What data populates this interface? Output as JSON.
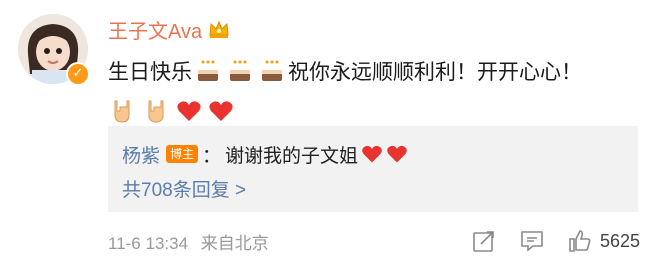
{
  "comment": {
    "username": "王子文Ava",
    "text_part1": "生日快乐",
    "text_part2": "祝你永远顺顺利利！开开心心！"
  },
  "reply": {
    "username": "杨紫",
    "tag": "博主",
    "separator": "：",
    "text": "谢谢我的子文姐",
    "more_label": "共708条回复 >"
  },
  "footer": {
    "date": "11-6 13:34",
    "source": "来自北京",
    "like_count": "5625"
  },
  "icons": {
    "verified": "verified-badge-icon",
    "crown": "crown-icon",
    "cake": "cake-icon",
    "hand": "rock-hand-icon",
    "heart": "heart-icon",
    "share": "share-icon",
    "comment": "comment-icon",
    "like": "thumbs-up-icon"
  },
  "colors": {
    "username": "#eb7350",
    "link": "#5b7dab",
    "tag_bg": "#ff8200",
    "reply_bg": "#f2f2f2",
    "meta": "#9a9a9a",
    "heart": "#e8332f"
  }
}
